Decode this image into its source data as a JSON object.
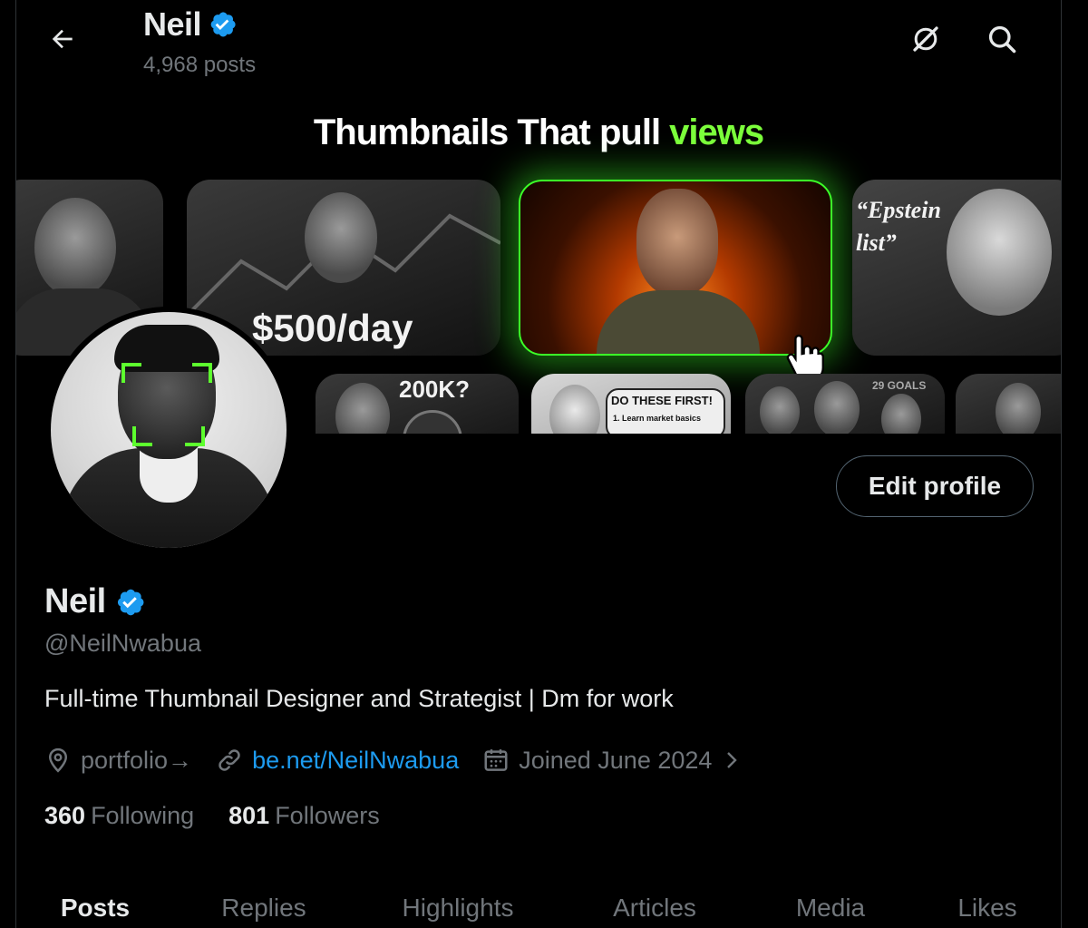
{
  "header": {
    "name": "Neil",
    "posts_count": "4,968 posts",
    "back_icon": "arrow-left-icon",
    "grok_icon": "grok-icon",
    "search_icon": "search-icon"
  },
  "banner": {
    "title_main": "Thumbnails That pull ",
    "title_accent": "views",
    "accent_color": "#7cff3b",
    "thumbnails": [
      {
        "caption": ""
      },
      {
        "caption": "$500/day"
      },
      {
        "caption": ""
      },
      {
        "caption": "“Epstein list”"
      },
      {
        "caption": "200K?"
      },
      {
        "caption": "DO THESE FIRST!"
      },
      {
        "caption": "1. Learn market basics"
      },
      {
        "caption": "29 GOALS"
      }
    ]
  },
  "profile": {
    "name": "Neil",
    "verified_color": "#1d9bf0",
    "handle": "@NeilNwabua",
    "bio": "Full-time Thumbnail Designer and Strategist | Dm for work",
    "location": "portfolio→",
    "website": "be.net/NeilNwabua",
    "joined": "Joined June 2024",
    "following_count": "360",
    "following_label": "Following",
    "followers_count": "801",
    "followers_label": "Followers",
    "edit_label": "Edit profile"
  },
  "tabs": [
    {
      "label": "Posts",
      "active": true
    },
    {
      "label": "Replies",
      "active": false
    },
    {
      "label": "Highlights",
      "active": false
    },
    {
      "label": "Articles",
      "active": false
    },
    {
      "label": "Media",
      "active": false
    },
    {
      "label": "Likes",
      "active": false
    }
  ]
}
